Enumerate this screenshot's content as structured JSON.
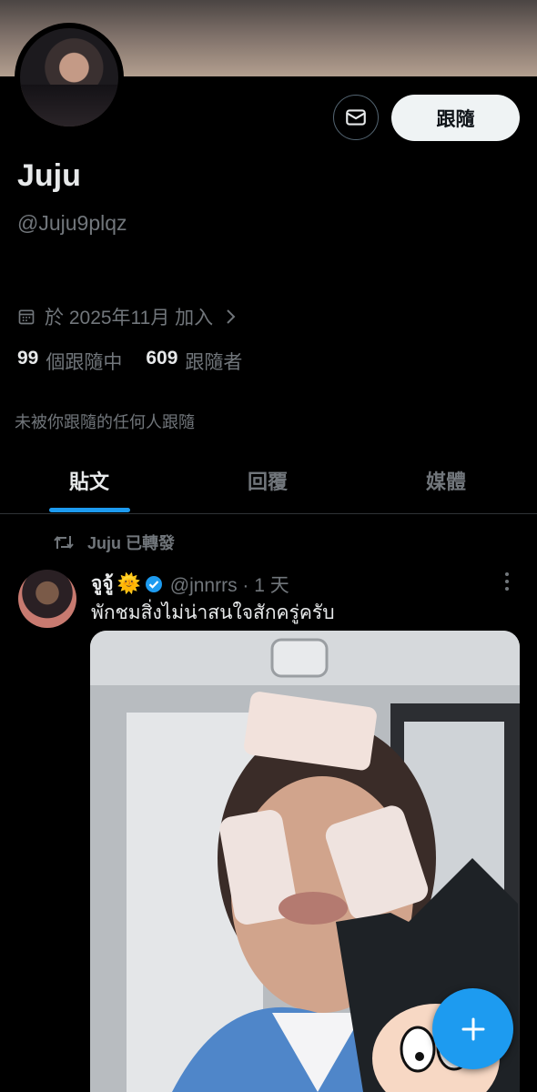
{
  "profile": {
    "name": "Juju",
    "handle": "@Juju9plqz",
    "joined": "於 2025年11月 加入",
    "following_count": "99",
    "following_label": "個跟隨中",
    "followers_count": "609",
    "followers_label": "跟隨者",
    "followed_note": "未被你跟隨的任何人跟隨"
  },
  "actions": {
    "follow_label": "跟隨"
  },
  "tabs": [
    {
      "label": "貼文",
      "active": true
    },
    {
      "label": "回覆",
      "active": false
    },
    {
      "label": "媒體",
      "active": false
    }
  ],
  "post": {
    "repost_label": "Juju 已轉發",
    "author_name": "จูจู้",
    "author_emoji": "🌞",
    "handle_time": "@jnnrrs · 1 天",
    "text": "พักชมสิ่งไม่น่าสนใจสักครู่ครับ"
  },
  "colors": {
    "accent": "#1d9bf0",
    "background": "#000000",
    "muted": "#71767b"
  },
  "icons": [
    "envelope-icon",
    "calendar-icon",
    "chevron-right-icon",
    "repost-icon",
    "verified-badge-icon",
    "more-vertical-icon",
    "plus-icon"
  ]
}
